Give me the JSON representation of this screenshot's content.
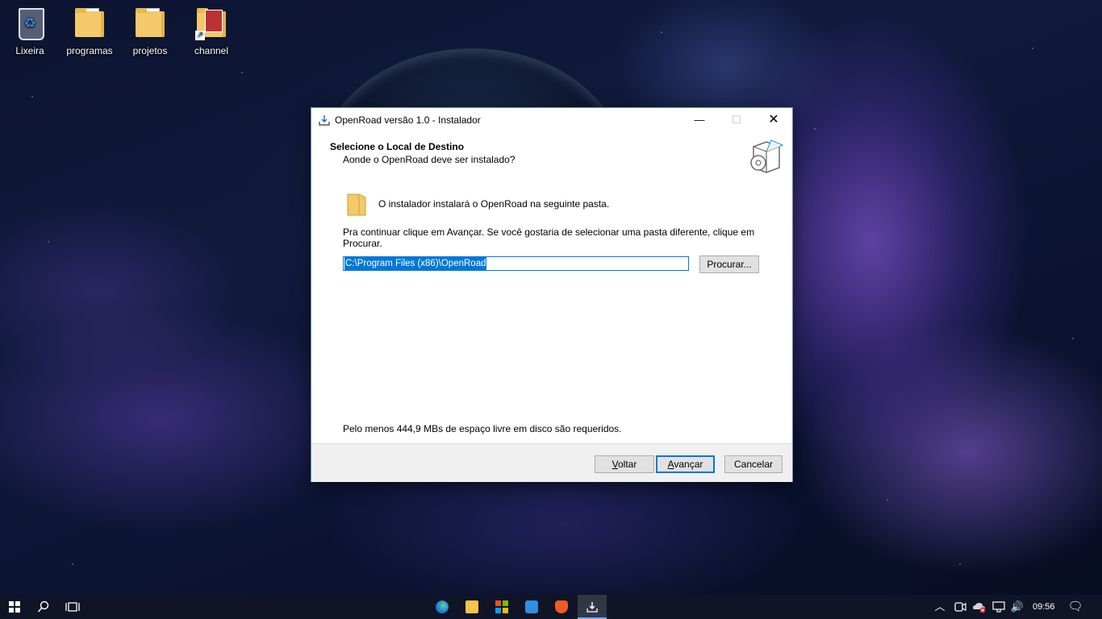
{
  "desktop": {
    "icons": [
      {
        "label": "Lixeira",
        "icon": "recycle-bin-icon"
      },
      {
        "label": "programas",
        "icon": "folder-icon"
      },
      {
        "label": "projetos",
        "icon": "folder-icon"
      },
      {
        "label": "channel",
        "icon": "folder-shortcut-icon"
      }
    ]
  },
  "installer": {
    "title": "OpenRoad versão 1.0 - Instalador",
    "header_title": "Selecione o Local de Destino",
    "header_subtitle": "Aonde o OpenRoad deve ser instalado?",
    "info_text": "O instalador instalará o OpenRoad na seguinte pasta.",
    "continue_text": "Pra continuar clique em Avançar. Se você gostaria de selecionar uma pasta diferente, clique em Procurar.",
    "path_value": "C:\\Program Files (x86)\\OpenRoad",
    "browse_label": "Procurar...",
    "space_text": "Pelo menos 444,9 MBs de espaço livre em disco são requeridos.",
    "back_label_u": "V",
    "back_label_rest": "oltar",
    "next_label_u": "A",
    "next_label_rest": "vançar",
    "cancel_label": "Cancelar",
    "min_glyph": "—",
    "max_glyph": "☐",
    "close_glyph": "✕"
  },
  "taskbar": {
    "apps": [
      "edge-icon",
      "file-explorer-icon",
      "store-icon",
      "mail-icon",
      "brave-icon",
      "installer-icon"
    ],
    "tray": {
      "chevron": "︿",
      "time": "09:56",
      "volume": "🔊",
      "notification": "🗨"
    }
  }
}
